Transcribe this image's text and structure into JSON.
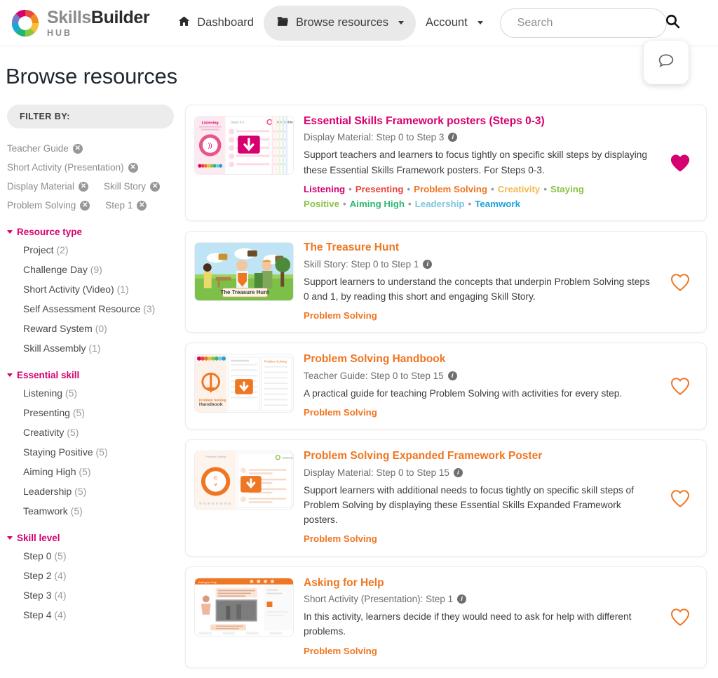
{
  "brand": {
    "line1_part1": "Skills",
    "line1_part2": "Builder",
    "line2": "HUB",
    "logo_icon": "colored-ring-logo"
  },
  "nav": {
    "dashboard": {
      "label": "Dashboard",
      "icon": "home-icon"
    },
    "browse": {
      "label": "Browse resources",
      "icon": "resources-icon"
    },
    "account": {
      "label": "Account"
    },
    "search": {
      "placeholder": "Search",
      "value": "",
      "icon": "search-icon"
    },
    "chat": {
      "icon": "chat-bubble-icon"
    }
  },
  "page": {
    "title": "Browse resources"
  },
  "sidebar": {
    "filter_header": "FILTER BY:",
    "active_filters": [
      {
        "label": "Teacher Guide"
      },
      {
        "label": "Short Activity (Presentation)"
      },
      {
        "label": "Display Material"
      },
      {
        "label": "Skill Story"
      },
      {
        "label": "Problem Solving"
      },
      {
        "label": "Step 1"
      }
    ],
    "facets": [
      {
        "title": "Resource type",
        "options": [
          {
            "label": "Project",
            "count": "(2)"
          },
          {
            "label": "Challenge Day",
            "count": "(9)"
          },
          {
            "label": "Short Activity (Video)",
            "count": "(1)"
          },
          {
            "label": "Self Assessment Resource",
            "count": "(3)"
          },
          {
            "label": "Reward System",
            "count": "(0)"
          },
          {
            "label": "Skill Assembly",
            "count": "(1)"
          }
        ]
      },
      {
        "title": "Essential skill",
        "options": [
          {
            "label": "Listening",
            "count": "(5)"
          },
          {
            "label": "Presenting",
            "count": "(5)"
          },
          {
            "label": "Creativity",
            "count": "(5)"
          },
          {
            "label": "Staying Positive",
            "count": "(5)"
          },
          {
            "label": "Aiming High",
            "count": "(5)"
          },
          {
            "label": "Leadership",
            "count": "(5)"
          },
          {
            "label": "Teamwork",
            "count": "(5)"
          }
        ]
      },
      {
        "title": "Skill level",
        "options": [
          {
            "label": "Step 0",
            "count": "(5)"
          },
          {
            "label": "Step 2",
            "count": "(4)"
          },
          {
            "label": "Step 3",
            "count": "(4)"
          },
          {
            "label": "Step 4",
            "count": "(4)"
          }
        ]
      }
    ]
  },
  "skill_colors": {
    "Listening": "#d6006e",
    "Presenting": "#e8463c",
    "Problem Solving": "#ef7622",
    "Creativity": "#f2b94b",
    "Staying Positive": "#8bc34a",
    "Aiming High": "#2eb872",
    "Leadership": "#7fc6e0",
    "Teamwork": "#1fa3d8"
  },
  "results": [
    {
      "title": "Essential Skills Framework posters (Steps 0-3)",
      "title_color": "#d6006e",
      "meta": "Display Material: Step 0 to Step 3",
      "description": "Support teachers and learners to focus tightly on specific skill steps by displaying these Essential Skills Framework posters. For Steps 0-3.",
      "skills": [
        "Listening",
        "Presenting",
        "Problem Solving",
        "Creativity",
        "Staying Positive",
        "Aiming High",
        "Leadership",
        "Teamwork"
      ],
      "favourite": true,
      "thumb": "framework-poster-thumbnail"
    },
    {
      "title": "The Treasure Hunt",
      "title_color": "#ef7622",
      "meta": "Skill Story: Step 0 to Step 1",
      "description": "Support learners to understand the concepts that underpin Problem Solving steps 0 and 1, by reading this short and engaging Skill Story.",
      "skills": [
        "Problem Solving"
      ],
      "favourite": false,
      "thumb": "treasure-hunt-thumbnail"
    },
    {
      "title": "Problem Solving Handbook",
      "title_color": "#ef7622",
      "meta": "Teacher Guide: Step 0 to Step 15",
      "description": "A practical guide for teaching Problem Solving with activities for every step.",
      "skills": [
        "Problem Solving"
      ],
      "favourite": false,
      "thumb": "handbook-thumbnail"
    },
    {
      "title": "Problem Solving Expanded Framework Poster",
      "title_color": "#ef7622",
      "meta": "Display Material: Step 0 to Step 15",
      "description": "Support learners with additional needs to focus tightly on specific skill steps of Problem Solving by displaying these Essential Skills Expanded Framework posters.",
      "skills": [
        "Problem Solving"
      ],
      "favourite": false,
      "thumb": "expanded-framework-thumbnail"
    },
    {
      "title": "Asking for Help",
      "title_color": "#ef7622",
      "meta": "Short Activity (Presentation): Step 1",
      "description": "In this activity, learners decide if they would need to ask for help with different problems.",
      "skills": [
        "Problem Solving"
      ],
      "favourite": false,
      "thumb": "asking-for-help-thumbnail"
    }
  ]
}
